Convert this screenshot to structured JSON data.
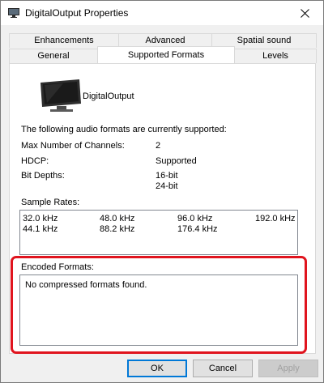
{
  "window": {
    "title": "DigitalOutput Properties",
    "close_icon": "close-icon",
    "accent_color": "#0078d7",
    "highlight_color": "#e0141e"
  },
  "tabs": {
    "row1": [
      {
        "label": "Enhancements"
      },
      {
        "label": "Advanced"
      },
      {
        "label": "Spatial sound"
      }
    ],
    "row2": [
      {
        "label": "General"
      },
      {
        "label": "Supported Formats",
        "active": true
      },
      {
        "label": "Levels"
      }
    ]
  },
  "device": {
    "name": "DigitalOutput",
    "icon": "monitor-icon"
  },
  "info": {
    "intro": "The following audio formats are currently supported:",
    "channels_label": "Max Number of Channels:",
    "channels_value": "2",
    "hdcp_label": "HDCP:",
    "hdcp_value": "Supported",
    "bit_depths_label": "Bit Depths:",
    "bit_depths": [
      "16-bit",
      "24-bit"
    ]
  },
  "sample_rates": {
    "label": "Sample Rates:",
    "rows": [
      [
        "32.0 kHz",
        "48.0 kHz",
        "96.0 kHz",
        "192.0 kHz"
      ],
      [
        "44.1 kHz",
        "88.2 kHz",
        "176.4 kHz"
      ]
    ]
  },
  "encoded": {
    "label": "Encoded Formats:",
    "message": "No compressed formats found."
  },
  "buttons": {
    "ok": "OK",
    "cancel": "Cancel",
    "apply": "Apply"
  }
}
